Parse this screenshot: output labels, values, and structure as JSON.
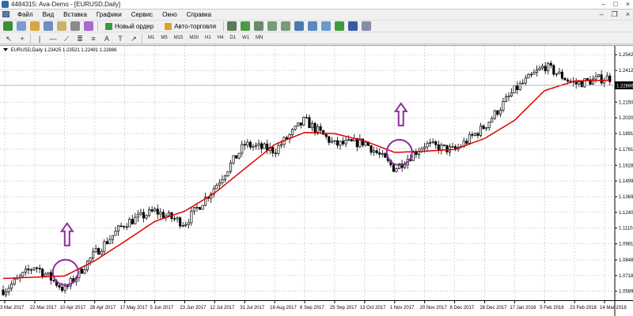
{
  "window": {
    "title": "4484315: Ava-Demo - [EURUSD,Daily]"
  },
  "menu": {
    "items": [
      {
        "label": "Файл"
      },
      {
        "label": "Вид"
      },
      {
        "label": "Вставка"
      },
      {
        "label": "Графики"
      },
      {
        "label": "Сервис"
      },
      {
        "label": "Окно"
      },
      {
        "label": "Справка"
      }
    ]
  },
  "toolbar": {
    "new_order_label": "Новый ордер",
    "auto_trading_label": "Авто-торговля",
    "timeframes": [
      "M1",
      "M5",
      "M15",
      "M30",
      "H1",
      "H4",
      "D1",
      "W1",
      "MN"
    ],
    "active_timeframe": "D1"
  },
  "chart": {
    "symbol_line": "EURUSD,Daily  1.23425 1.23521 1.22491 1.22886",
    "current_price": "1.22886",
    "colors": {
      "candle": "#000000",
      "ma": "#e00000",
      "marker": "#8b2f9a",
      "grid": "#c8c8c8",
      "price_tag": "#000000"
    }
  },
  "chart_data": {
    "type": "candlestick",
    "symbol": "EURUSD",
    "timeframe": "Daily",
    "ohlc_last": {
      "open": 1.23425,
      "high": 1.23521,
      "low": 1.22491,
      "close": 1.22886
    },
    "price_range": [
      1.0515,
      1.2615
    ],
    "y_ticks": [
      "1.25420",
      "1.24120",
      "1.22886",
      "1.21500",
      "1.20205",
      "1.18910",
      "1.17615",
      "1.16285",
      "1.14990",
      "1.13695",
      "1.12400",
      "1.11105",
      "1.09810",
      "1.08480",
      "1.07185",
      "1.05890",
      "1.04595"
    ],
    "x_ticks": [
      "3 Mar 2017",
      "22 Mar 2017",
      "10 Apr 2017",
      "28 Apr 2017",
      "17 May 2017",
      "5 Jun 2017",
      "23 Jun 2017",
      "12 Jul 2017",
      "31 Jul 2017",
      "18 Aug 2017",
      "6 Sep 2017",
      "25 Sep 2017",
      "13 Oct 2017",
      "1 Nov 2017",
      "20 Nov 2017",
      "8 Dec 2017",
      "28 Dec 2017",
      "17 Jan 2018",
      "5 Feb 2018",
      "23 Feb 2018",
      "14 Mar 2018"
    ],
    "moving_average_path": [
      [
        "3 Mar 2017",
        1.0695
      ],
      [
        "22 Mar 2017",
        1.0705
      ],
      [
        "10 Apr 2017",
        1.0715
      ],
      [
        "28 Apr 2017",
        1.084
      ],
      [
        "17 May 2017",
        1.1
      ],
      [
        "5 Jun 2017",
        1.1165
      ],
      [
        "23 Jun 2017",
        1.125
      ],
      [
        "12 Jul 2017",
        1.14
      ],
      [
        "31 Jul 2017",
        1.16
      ],
      [
        "18 Aug 2017",
        1.18
      ],
      [
        "6 Sep 2017",
        1.19
      ],
      [
        "25 Sep 2017",
        1.189
      ],
      [
        "13 Oct 2017",
        1.183
      ],
      [
        "1 Nov 2017",
        1.1735
      ],
      [
        "20 Nov 2017",
        1.1745
      ],
      [
        "8 Dec 2017",
        1.176
      ],
      [
        "28 Dec 2017",
        1.185
      ],
      [
        "17 Jan 2018",
        1.2
      ],
      [
        "5 Feb 2018",
        1.2245
      ],
      [
        "23 Feb 2018",
        1.2325
      ],
      [
        "14 Mar 2018",
        1.233
      ]
    ],
    "price_path": [
      [
        "3 Mar 2017",
        1.06
      ],
      [
        "22 Mar 2017",
        1.08
      ],
      [
        "10 Apr 2017",
        1.06
      ],
      [
        "28 Apr 2017",
        1.09
      ],
      [
        "17 May 2017",
        1.115
      ],
      [
        "5 Jun 2017",
        1.125
      ],
      [
        "23 Jun 2017",
        1.115
      ],
      [
        "12 Jul 2017",
        1.145
      ],
      [
        "31 Jul 2017",
        1.18
      ],
      [
        "18 Aug 2017",
        1.175
      ],
      [
        "6 Sep 2017",
        1.2
      ],
      [
        "25 Sep 2017",
        1.18
      ],
      [
        "13 Oct 2017",
        1.182
      ],
      [
        "1 Nov 2017",
        1.16
      ],
      [
        "20 Nov 2017",
        1.18
      ],
      [
        "8 Dec 2017",
        1.175
      ],
      [
        "28 Dec 2017",
        1.195
      ],
      [
        "17 Jan 2018",
        1.225
      ],
      [
        "5 Feb 2018",
        1.245
      ],
      [
        "23 Feb 2018",
        1.23
      ],
      [
        "14 Mar 2018",
        1.235
      ]
    ],
    "annotations": [
      {
        "type": "circle",
        "at": [
          "10 Apr 2017",
          1.0745
        ],
        "arrow": "up"
      },
      {
        "type": "circle",
        "at": [
          "1 Nov 2017",
          1.1735
        ],
        "arrow": "up"
      }
    ],
    "grid": true
  }
}
